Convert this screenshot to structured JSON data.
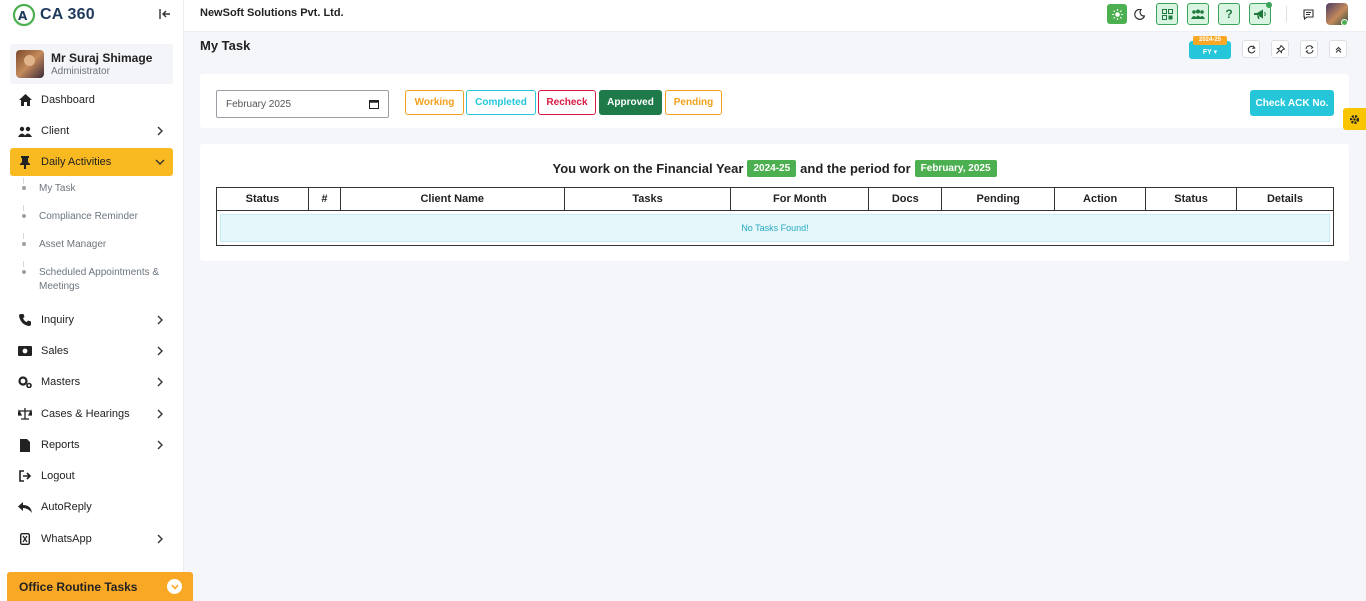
{
  "brand": {
    "name": "CA 360"
  },
  "user": {
    "name": "Mr Suraj Shimage",
    "role": "Administrator"
  },
  "sidebar": {
    "items": [
      {
        "label": "Dashboard"
      },
      {
        "label": "Client"
      },
      {
        "label": "Daily Activities"
      },
      {
        "label": "Inquiry"
      },
      {
        "label": "Sales"
      },
      {
        "label": "Masters"
      },
      {
        "label": "Cases & Hearings"
      },
      {
        "label": "Reports"
      },
      {
        "label": "Logout"
      },
      {
        "label": "AutoReply"
      },
      {
        "label": "WhatsApp"
      }
    ],
    "sub_items": [
      {
        "label": "My Task"
      },
      {
        "label": "Compliance Reminder"
      },
      {
        "label": "Asset Manager"
      },
      {
        "label": "Scheduled Appointments &"
      },
      {
        "label": "Meetings"
      }
    ],
    "office_label": "Office Routine Tasks"
  },
  "header": {
    "company": "NewSoft Solutions Pvt. Ltd.",
    "help_label": "?"
  },
  "page": {
    "title": "My Task",
    "fy_tag": "2024-25",
    "fy_button": "FY ▾"
  },
  "filters": {
    "month_value": "February 2025",
    "working": "Working",
    "completed": "Completed",
    "recheck": "Recheck",
    "approved": "Approved",
    "pending": "Pending",
    "check_ack": "Check ACK No."
  },
  "summary": {
    "prefix": "You work on the Financial Year",
    "fy": "2024-25",
    "middle": "and the period for",
    "period": "February, 2025"
  },
  "table": {
    "headers": [
      "Status",
      "#",
      "Client Name",
      "Tasks",
      "For Month",
      "Docs",
      "Pending",
      "Action",
      "Status",
      "Details"
    ],
    "empty_message": "No Tasks Found!"
  },
  "colors": {
    "accent_yellow": "#f9b921",
    "cyan": "#26c6da",
    "green": "#4caf50",
    "approved_green": "#1f7a4a",
    "recheck_red": "#d81b44",
    "working_orange": "#f0a01d"
  }
}
